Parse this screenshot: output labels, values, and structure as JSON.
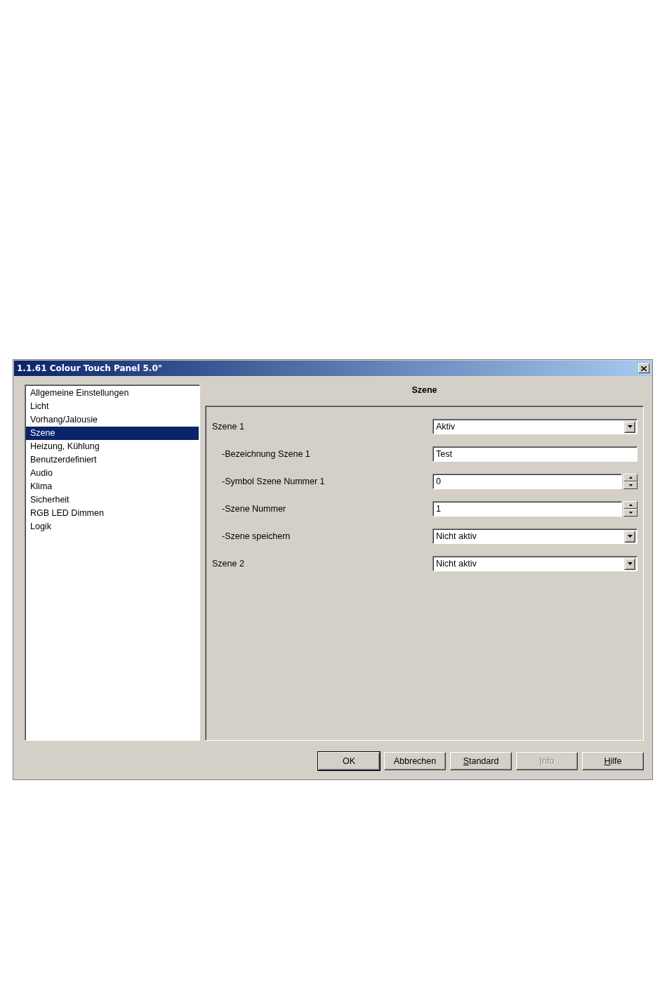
{
  "window": {
    "title": "1.1.61 Colour Touch Panel 5.0\""
  },
  "sidebar": {
    "items": [
      {
        "label": "Allgemeine Einstellungen",
        "selected": false
      },
      {
        "label": "Licht",
        "selected": false
      },
      {
        "label": "Vorhang/Jalousie",
        "selected": false
      },
      {
        "label": "Szene",
        "selected": true
      },
      {
        "label": "Heizung, Kühlung",
        "selected": false
      },
      {
        "label": "Benutzerdefiniert",
        "selected": false
      },
      {
        "label": "Audio",
        "selected": false
      },
      {
        "label": "Klima",
        "selected": false
      },
      {
        "label": "Sicherheit",
        "selected": false
      },
      {
        "label": "RGB LED Dimmen",
        "selected": false
      },
      {
        "label": "Logik",
        "selected": false
      }
    ]
  },
  "panel": {
    "heading": "Szene",
    "parameters": [
      {
        "label": "Szene 1",
        "kind": "dropdown",
        "value": "Aktiv",
        "children": [
          {
            "label": "-Bezeichnung Szene 1",
            "kind": "text",
            "value": "Test"
          },
          {
            "label": "-Symbol Szene Nummer 1",
            "kind": "spin",
            "value": "0"
          },
          {
            "label": "-Szene Nummer",
            "kind": "spin",
            "value": "1"
          },
          {
            "label": "-Szene speichern",
            "kind": "dropdown",
            "value": "Nicht aktiv"
          }
        ]
      },
      {
        "label": "Szene 2",
        "kind": "dropdown",
        "value": "Nicht aktiv"
      }
    ]
  },
  "buttons": [
    {
      "label": "OK",
      "default": true,
      "disabled": false,
      "underline_first": false
    },
    {
      "label": "Abbrechen",
      "default": false,
      "disabled": false,
      "underline_first": false
    },
    {
      "label": "Standard",
      "default": false,
      "disabled": false,
      "underline_first": true
    },
    {
      "label": "Info",
      "default": false,
      "disabled": true,
      "underline_first": true
    },
    {
      "label": "Hilfe",
      "default": false,
      "disabled": false,
      "underline_first": true
    }
  ]
}
